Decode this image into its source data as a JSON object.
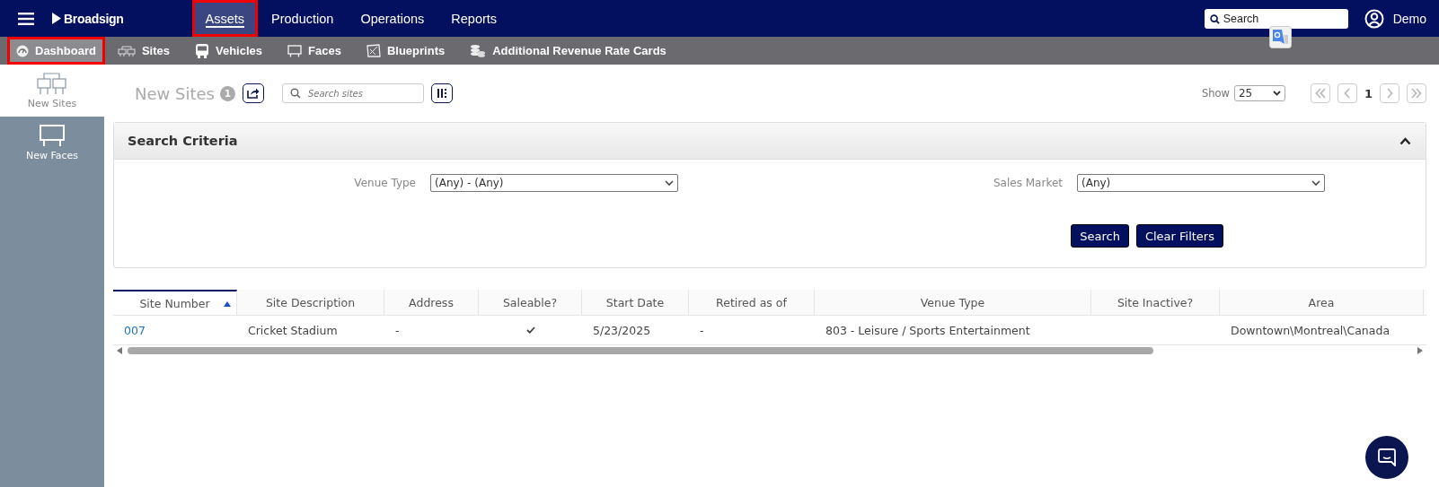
{
  "top_nav": {
    "brand": "Broadsign",
    "items": [
      {
        "label": "Assets",
        "selected": true,
        "annotated": true
      },
      {
        "label": "Production",
        "selected": false,
        "annotated": false
      },
      {
        "label": "Operations",
        "selected": false,
        "annotated": false
      },
      {
        "label": "Reports",
        "selected": false,
        "annotated": false
      }
    ],
    "search": {
      "placeholder": "Search"
    },
    "user": "Demo"
  },
  "sub_nav": [
    {
      "label": "Dashboard",
      "kind": "dashboard",
      "selected": true,
      "annotated": true
    },
    {
      "label": "Sites",
      "kind": "sites",
      "selected": false,
      "annotated": false
    },
    {
      "label": "Vehicles",
      "kind": "vehicles",
      "selected": false,
      "annotated": false
    },
    {
      "label": "Faces",
      "kind": "faces",
      "selected": false,
      "annotated": false
    },
    {
      "label": "Blueprints",
      "kind": "blueprints",
      "selected": false,
      "annotated": false
    },
    {
      "label": "Additional Revenue Rate Cards",
      "kind": "coins",
      "selected": false,
      "annotated": false
    }
  ],
  "sidebar": [
    {
      "label": "New Sites",
      "kind": "sites",
      "selected": true
    },
    {
      "label": "New Faces",
      "kind": "faces",
      "selected": false
    }
  ],
  "header": {
    "title": "New Sites",
    "count": "1",
    "search_placeholder": "Search sites",
    "show_label": "Show",
    "page_size": "25",
    "page": "1"
  },
  "search_criteria": {
    "title": "Search Criteria",
    "expanded": true,
    "filters": [
      {
        "label": "Venue Type",
        "value": "(Any) - (Any)"
      },
      {
        "label": "Sales Market",
        "value": "(Any)"
      }
    ],
    "buttons": [
      "Search",
      "Clear Filters"
    ]
  },
  "table": {
    "columns": [
      {
        "label": "Site Number",
        "sorted": true
      },
      {
        "label": "Site Description",
        "sorted": false
      },
      {
        "label": "Address",
        "sorted": false
      },
      {
        "label": "Saleable?",
        "sorted": false
      },
      {
        "label": "Start Date",
        "sorted": false
      },
      {
        "label": "Retired as of",
        "sorted": false
      },
      {
        "label": "Venue Type",
        "sorted": false
      },
      {
        "label": "Site Inactive?",
        "sorted": false
      },
      {
        "label": "Area",
        "sorted": false
      }
    ],
    "rows": [
      {
        "site_number": "007",
        "site_description": "Cricket Stadium",
        "address": "-",
        "saleable": true,
        "start_date": "5/23/2025",
        "retired_as_of": "-",
        "venue_type": "803 - Leisure / Sports Entertainment",
        "site_inactive": false,
        "area": "Downtown\\Montreal\\Canada"
      }
    ]
  }
}
